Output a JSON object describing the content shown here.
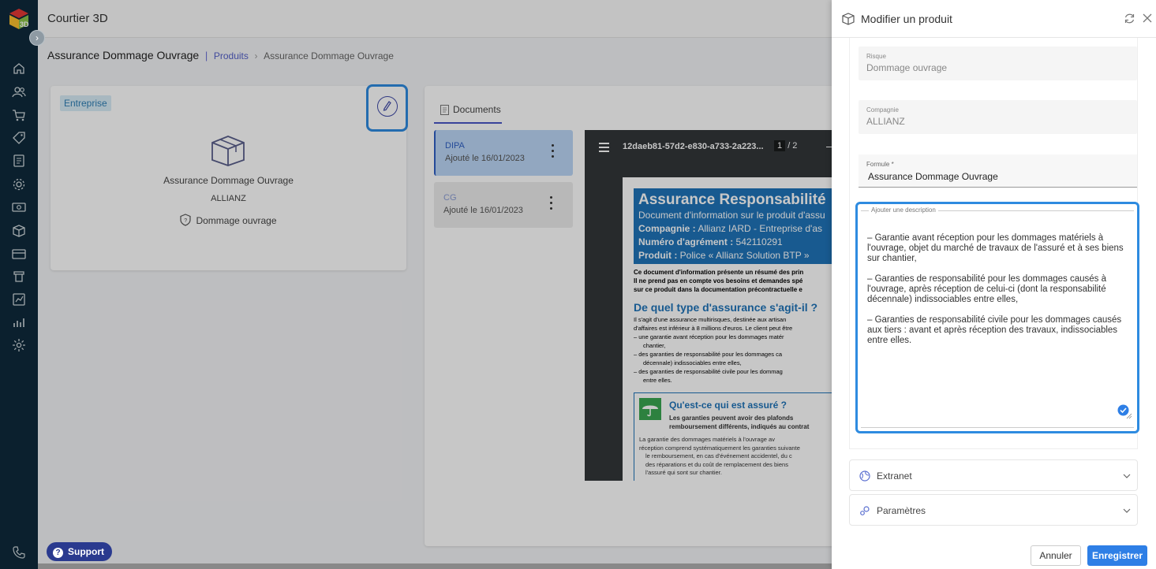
{
  "app": {
    "title": "Courtier 3D"
  },
  "breadcrumb": {
    "main": "Assurance Dommage Ouvrage",
    "separator": "|",
    "link": "Produits",
    "current": "Assurance Dommage Ouvrage"
  },
  "product_card": {
    "badge": "Entreprise",
    "title": "Assurance Dommage Ouvrage",
    "company": "ALLIANZ",
    "risk": "Dommage ouvrage"
  },
  "documents": {
    "tab_label": "Documents",
    "items": [
      {
        "name": "DIPA",
        "date": "Ajouté le 16/01/2023"
      },
      {
        "name": "CG",
        "date": "Ajouté le 16/01/2023"
      }
    ],
    "viewer": {
      "filename": "12daeb81-57d2-e830-a733-2a223...",
      "page_current": "1",
      "page_total": "/ 2",
      "header_title": "Assurance Responsabilité",
      "header_line1": "Document d'information sur le produit d'assu",
      "header_line2_label": "Compagnie :",
      "header_line2_value": " Allianz IARD - Entreprise d'as",
      "header_line3_label": "Numéro d'agrément :",
      "header_line3_value": " 542110291",
      "header_line4_label": "Produit :",
      "header_line4_value": " Police « Allianz Solution BTP »",
      "bold_line1": "Ce document d'information présente un résumé des prin",
      "bold_line2": "Il ne prend pas en compte vos besoins et demandes spé",
      "bold_line3": "sur ce produit dans la documentation précontractuelle e",
      "section_title": "De quel type d'assurance s'agit-il ?",
      "body_lines": [
        "Il s'agit d'une assurance multirisques, destinée aux artisan",
        "d'affaires est inférieur à 8 millions d'euros. Le client peut être",
        "–  une garantie avant réception pour les dommages matér",
        "chantier,",
        "–  des garanties de responsabilité pour les dommages ca",
        "décennale) indissociables entre elles,",
        "–  des garanties de responsabilité civile pour les dommag",
        "entre elles."
      ],
      "box_title": "Qu'est-ce qui est assuré ?",
      "box_sub1": "Les garanties peuvent avoir des plafonds",
      "box_sub2": "remboursement différents, indiqués au contrat",
      "box_body": [
        "La garantie des dommages matériels à l'ouvrage av",
        "réception comprend systématiquement les garanties suivante",
        "le remboursement, en cas d'événement accidentel, du c",
        "des réparations et du coût de remplacement des biens",
        "l'assuré qui sont sur chantier."
      ]
    }
  },
  "support": {
    "label": "Support"
  },
  "drawer": {
    "title": "Modifier un produit",
    "fields": {
      "risque": {
        "label": "Risque",
        "value": "Dommage ouvrage"
      },
      "compagnie": {
        "label": "Compagnie",
        "value": "ALLIANZ"
      },
      "formule": {
        "label": "Formule *",
        "value": "Assurance Dommage Ouvrage"
      }
    },
    "description": {
      "label": "Ajouter une description",
      "value": "– Garantie avant réception pour les dommages matériels à l'ouvrage, objet du marché de travaux de l'assuré et à ses biens sur chantier,\n\n– Garanties de responsabilité pour les dommages causés à l'ouvrage, après réception de celui-ci (dont la responsabilité décennale) indissociables entre elles,\n\n– Garanties de responsabilité civile pour les dommages causés aux tiers : avant et après réception des travaux, indissociables entre elles."
    },
    "accordions": [
      {
        "label": "Extranet"
      },
      {
        "label": "Paramètres"
      }
    ],
    "buttons": {
      "cancel": "Annuler",
      "save": "Enregistrer"
    }
  },
  "colors": {
    "sidebar": "#0f2a3b",
    "accent": "#2e7fe6",
    "highlight": "#2e8be0",
    "pdf_blue": "#1f74b9"
  }
}
